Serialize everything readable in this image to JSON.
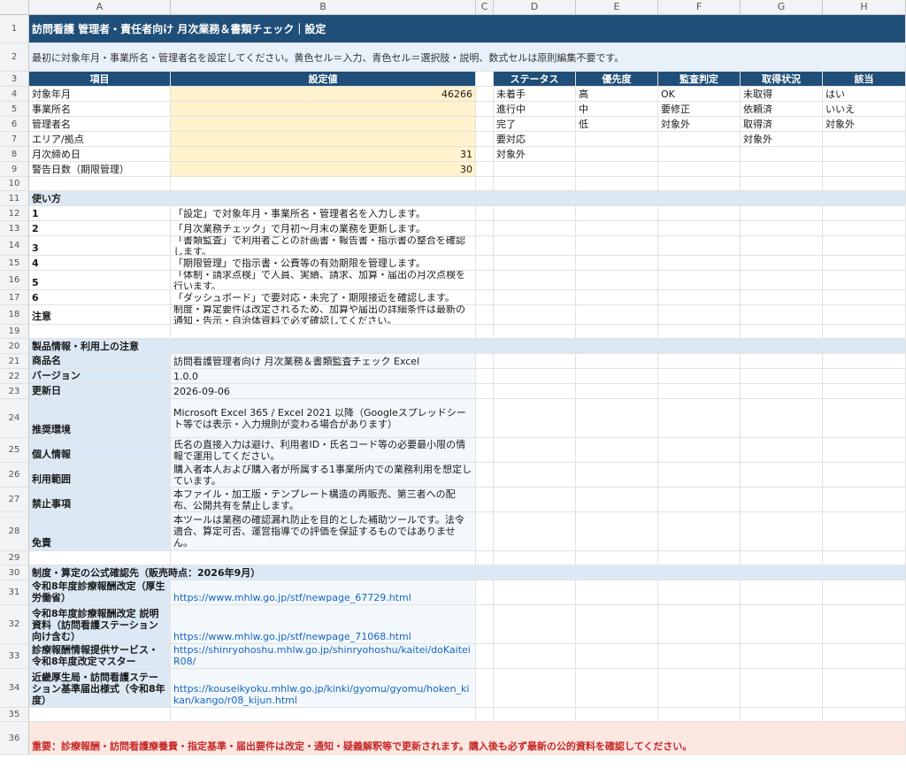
{
  "columns": [
    "A",
    "B",
    "C",
    "D",
    "E",
    "F",
    "G",
    "H"
  ],
  "rows": [
    "1",
    "2",
    "3",
    "4",
    "5",
    "6",
    "7",
    "8",
    "9",
    "10",
    "11",
    "12",
    "13",
    "14",
    "15",
    "16",
    "17",
    "18",
    "19",
    "20",
    "21",
    "22",
    "23",
    "24",
    "25",
    "26",
    "27",
    "28",
    "29",
    "30",
    "31",
    "32",
    "33",
    "34",
    "35",
    "36"
  ],
  "title": "訪問看護 管理者・責任者向け 月次業務＆書類チェック｜設定",
  "subtitle": "最初に対象年月・事業所名・管理者名を設定してください。黄色セル＝入力、青色セル＝選択肢・説明、数式セルは原則編集不要です。",
  "settings": {
    "header_item": "項目",
    "header_value": "設定値",
    "rows": [
      {
        "label": "対象年月",
        "value": "46266"
      },
      {
        "label": "事業所名",
        "value": ""
      },
      {
        "label": "管理者名",
        "value": ""
      },
      {
        "label": "エリア/拠点",
        "value": ""
      },
      {
        "label": "月次締め日",
        "value": "31"
      },
      {
        "label": "警告日数（期限管理）",
        "value": "30"
      }
    ]
  },
  "lists": {
    "headers": [
      "ステータス",
      "優先度",
      "監査判定",
      "取得状況",
      "該当"
    ],
    "status": [
      "未着手",
      "進行中",
      "完了",
      "要対応",
      "対象外"
    ],
    "priority": [
      "高",
      "中",
      "低"
    ],
    "audit": [
      "OK",
      "要修正",
      "対象外"
    ],
    "acquire": [
      "未取得",
      "依頼済",
      "取得済",
      "対象外"
    ],
    "applicable": [
      "はい",
      "いいえ",
      "対象外"
    ]
  },
  "usage": {
    "title": "使い方",
    "steps": [
      {
        "num": "1",
        "text": "「設定」で対象年月・事業所名・管理者名を入力します。"
      },
      {
        "num": "2",
        "text": "「月次業務チェック」で月初〜月末の業務を更新します。"
      },
      {
        "num": "3",
        "text": "「書類監査」で利用者ごとの計画書・報告書・指示書の整合を確認します。"
      },
      {
        "num": "4",
        "text": "「期限管理」で指示書・公費等の有効期限を管理します。"
      },
      {
        "num": "5",
        "text": "「体制・請求点検」で人員、実績、請求、加算・届出の月次点検を行います。"
      },
      {
        "num": "6",
        "text": "「ダッシュボード」で要対応・未完了・期限接近を確認します。"
      },
      {
        "num": "注意",
        "text": "制度・算定要件は改定されるため、加算や届出の詳細条件は最新の通知・告示・自治体資料で必ず確認してください。"
      }
    ]
  },
  "product": {
    "title": "製品情報・利用上の注意",
    "rows": [
      {
        "label": "商品名",
        "value": "訪問看護管理者向け 月次業務＆書類監査チェック Excel"
      },
      {
        "label": "バージョン",
        "value": "1.0.0"
      },
      {
        "label": "更新日",
        "value": "2026-09-06"
      },
      {
        "label": "推奨環境",
        "value": "Microsoft Excel 365 / Excel 2021 以降（Googleスプレッドシート等では表示・入力規則が変わる場合があります）"
      },
      {
        "label": "個人情報",
        "value": "氏名の直接入力は避け、利用者ID・氏名コード等の必要最小限の情報で運用してください。"
      },
      {
        "label": "利用範囲",
        "value": "購入者本人および購入者が所属する1事業所内での業務利用を想定しています。"
      },
      {
        "label": "禁止事項",
        "value": "本ファイル・加工版・テンプレート構造の再販売、第三者への配布、公開共有を禁止します。"
      },
      {
        "label": "免責",
        "value": "本ツールは業務の確認漏れ防止を目的とした補助ツールです。法令適合、算定可否、運営指導での評価を保証するものではありません。"
      }
    ]
  },
  "sources": {
    "title": "制度・算定の公式確認先（販売時点：2026年9月）",
    "rows": [
      {
        "label": "令和8年度診療報酬改定（厚生労働省）",
        "url": "https://www.mhlw.go.jp/stf/newpage_67729.html"
      },
      {
        "label": "令和8年度診療報酬改定 説明資料（訪問看護ステーション向け含む）",
        "url": "https://www.mhlw.go.jp/stf/newpage_71068.html"
      },
      {
        "label": "診療報酬情報提供サービス・令和8年度改定マスター",
        "url": "https://shinryohoshu.mhlw.go.jp/shinryohoshu/kaitei/doKaiteiR08/"
      },
      {
        "label": "近畿厚生局・訪問看護ステーション基準届出様式（令和8年度）",
        "url": "https://kouseikyoku.mhlw.go.jp/kinki/gyomu/gyomu/hoken_kikan/kango/r08_kijun.html"
      }
    ]
  },
  "warning": "重要：診療報酬・訪問看護療養費・指定基準・届出要件は改定・通知・疑義解釈等で更新されます。購入後も必ず最新の公的資料を確認してください。"
}
